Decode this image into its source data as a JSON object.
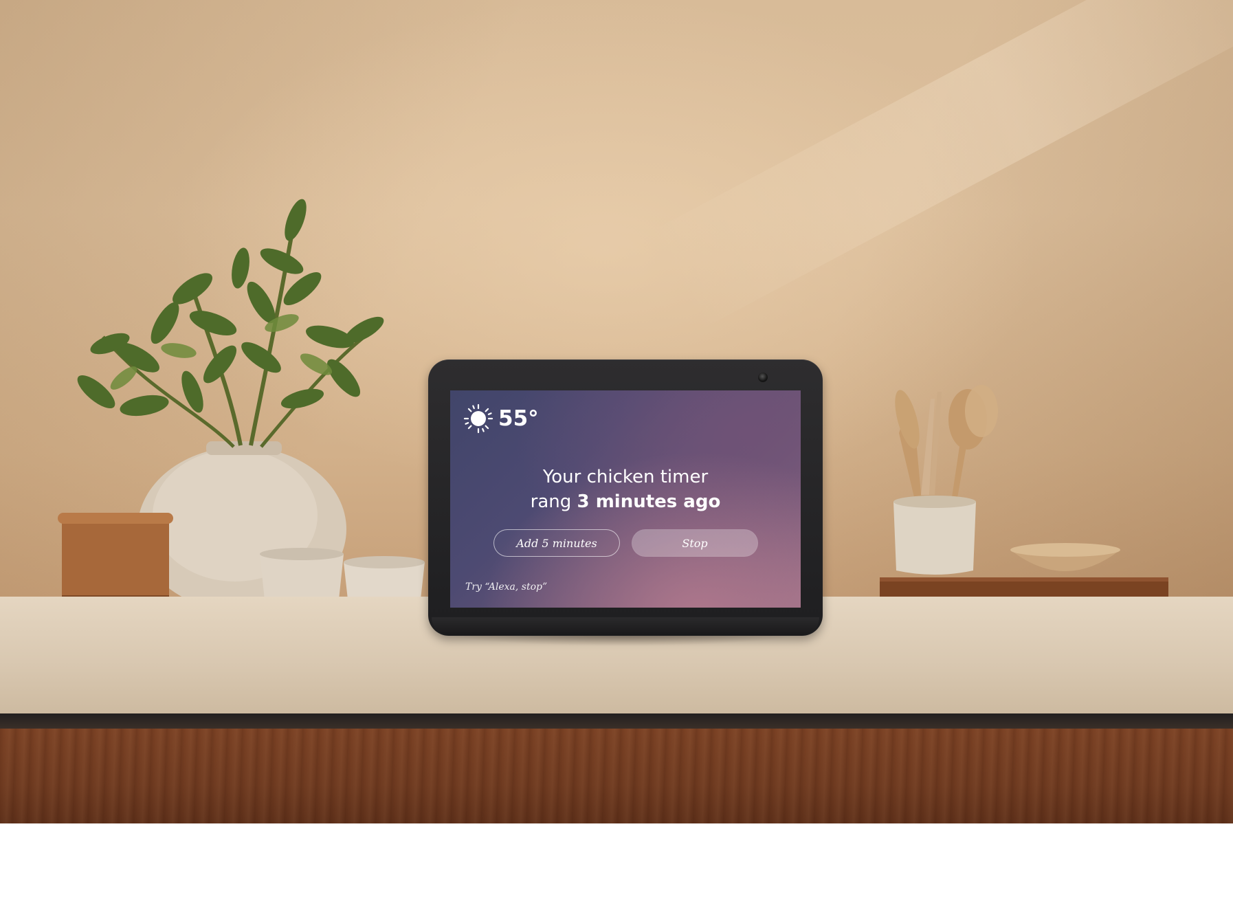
{
  "scene": {
    "wall_color": "#d8bb98",
    "counter_color": "#e5d6c1",
    "cabinet_color": "#6e3a20",
    "objects": [
      "potted-plant",
      "round-vase",
      "terracotta-pot",
      "small-bowls",
      "utensil-holder",
      "wooden-bowl",
      "cutting-board"
    ]
  },
  "device": {
    "frame_color": "#1e1e20",
    "camera_icon": "camera-icon"
  },
  "screen": {
    "weather": {
      "icon": "sun-icon",
      "temperature": "55°"
    },
    "message": {
      "line1": "Your chicken timer",
      "line2_prefix": "rang ",
      "line2_bold": "3 minutes ago"
    },
    "buttons": {
      "add_label": "Add 5 minutes",
      "stop_label": "Stop"
    },
    "hint": "Try “Alexa, stop”"
  }
}
